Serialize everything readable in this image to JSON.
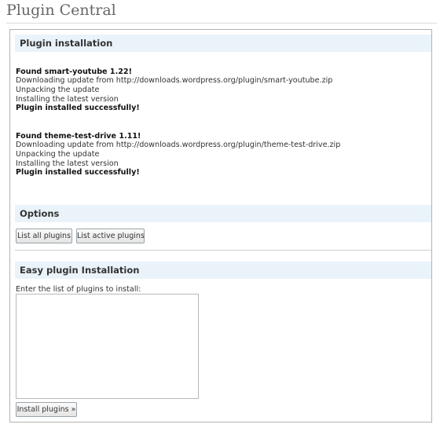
{
  "page": {
    "title": "Plugin Central"
  },
  "installation": {
    "heading": "Plugin installation",
    "entries": [
      {
        "found": "Found smart-youtube 1.22!",
        "downloading": "Downloading update from http://downloads.wordpress.org/plugin/smart-youtube.zip",
        "unpacking": "Unpacking the update",
        "installing": "Installing the latest version",
        "result": "Plugin installed successfully!"
      },
      {
        "found": "Found theme-test-drive 1.11!",
        "downloading": "Downloading update from http://downloads.wordpress.org/plugin/theme-test-drive.zip",
        "unpacking": "Unpacking the update",
        "installing": "Installing the latest version",
        "result": "Plugin installed successfully!"
      }
    ]
  },
  "options": {
    "heading": "Options",
    "list_all_label": "List all plugins",
    "list_active_label": "List active plugins"
  },
  "easy_install": {
    "heading": "Easy plugin Installation",
    "field_label": "Enter the list of plugins to install:",
    "textarea_value": "",
    "install_button_label": "Install plugins »"
  }
}
